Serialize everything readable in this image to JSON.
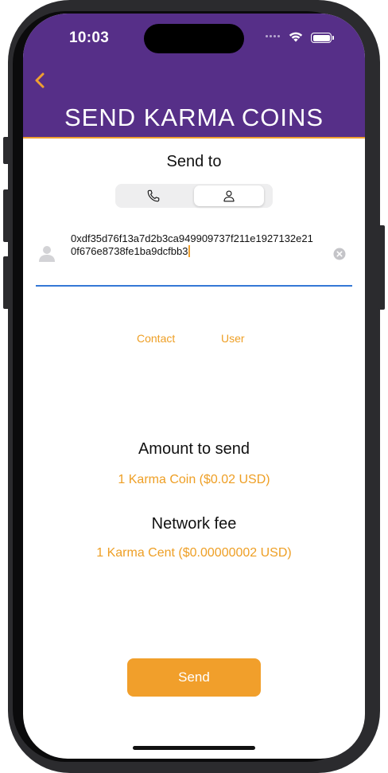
{
  "status_bar": {
    "time": "10:03"
  },
  "header": {
    "title": "SEND KARMA COINS",
    "back_icon": "chevron-left-icon"
  },
  "send_to": {
    "label": "Send to",
    "segments": [
      {
        "icon": "phone-icon",
        "selected": false
      },
      {
        "icon": "person-icon",
        "selected": true
      }
    ]
  },
  "address": {
    "value": "0xdf35d76f13a7d2b3ca949909737f211e1927132e210f676e8738fe1ba9dcfbb3"
  },
  "links": {
    "contact": "Contact",
    "user": "User"
  },
  "amount": {
    "label": "Amount to send",
    "value": "1 Karma Coin ($0.02 USD)"
  },
  "fee": {
    "label": "Network fee",
    "value": "1 Karma Cent ($0.00000002 USD)"
  },
  "send_button": {
    "label": "Send"
  },
  "colors": {
    "header": "#562f88",
    "accent": "#f19f2b",
    "underline": "#3478d6"
  }
}
